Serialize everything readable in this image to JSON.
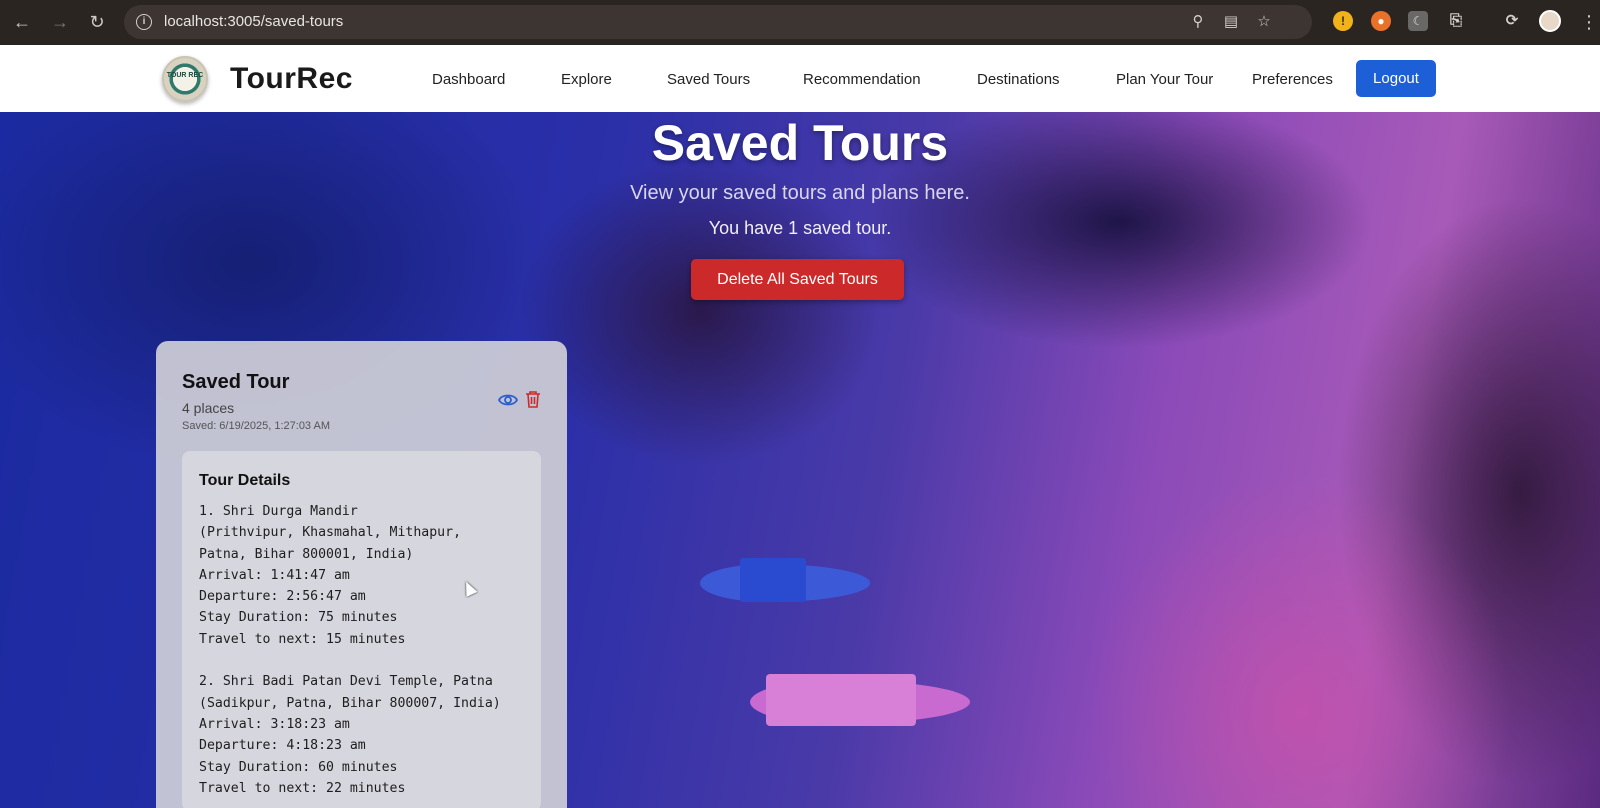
{
  "browser": {
    "url": "localhost:3005/saved-tours"
  },
  "header": {
    "brand": "TourRec",
    "logo_text": "TOUR REC",
    "nav": [
      "Dashboard",
      "Explore",
      "Saved Tours",
      "Recommendation",
      "Destinations",
      "Plan Your Tour",
      "Preferences"
    ],
    "logout": "Logout",
    "accent": "#1d5fd6"
  },
  "hero": {
    "title": "Saved Tours",
    "subtitle": "View your saved tours and plans here.",
    "count_text": "You have 1 saved tour.",
    "delete_all": "Delete All Saved Tours",
    "danger_color": "#cc2a2a"
  },
  "card": {
    "title": "Saved Tour",
    "places": "4 places",
    "saved": "Saved: 6/19/2025, 1:27:03 AM",
    "details_title": "Tour Details",
    "details_lines": [
      "1. Shri Durga Mandir",
      "(Prithvipur, Khasmahal, Mithapur,",
      "Patna, Bihar 800001, India)",
      "Arrival: 1:41:47 am",
      "Departure: 2:56:47 am",
      "Stay Duration: 75 minutes",
      "Travel to next: 15 minutes",
      "",
      "2. Shri Badi Patan Devi Temple, Patna",
      "(Sadikpur, Patna, Bihar 800007, India)",
      "Arrival: 3:18:23 am",
      "Departure: 4:18:23 am",
      "Stay Duration: 60 minutes",
      "Travel to next: 22 minutes"
    ]
  }
}
